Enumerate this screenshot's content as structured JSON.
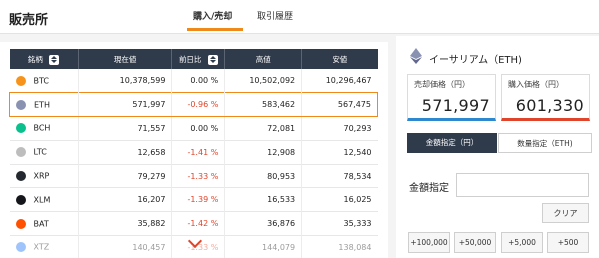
{
  "header": {
    "title": "販売所",
    "tabs": [
      {
        "label": "購入/売却"
      },
      {
        "label": "取引履歴"
      }
    ]
  },
  "table": {
    "columns": [
      "銘柄",
      "現在値",
      "前日比",
      "高値",
      "安値"
    ],
    "rows": [
      {
        "symbol": "BTC",
        "price": "10,378,599",
        "change": "0.00 %",
        "high": "10,502,092",
        "low": "10,296,467",
        "icon_color": "#f7931a"
      },
      {
        "symbol": "ETH",
        "price": "571,997",
        "change": "-0.96 %",
        "high": "583,462",
        "low": "567,475",
        "icon_color": "#8a92b2"
      },
      {
        "symbol": "BCH",
        "price": "71,557",
        "change": "0.00 %",
        "high": "72,081",
        "low": "70,293",
        "icon_color": "#0ac18e"
      },
      {
        "symbol": "LTC",
        "price": "12,658",
        "change": "-1.41 %",
        "high": "12,908",
        "low": "12,540",
        "icon_color": "#bdbdbd"
      },
      {
        "symbol": "XRP",
        "price": "79,279",
        "change": "-1.33 %",
        "high": "80,953",
        "low": "78,534",
        "icon_color": "#23292f"
      },
      {
        "symbol": "XLM",
        "price": "16,207",
        "change": "-1.39 %",
        "high": "16,533",
        "low": "16,025",
        "icon_color": "#14161b"
      },
      {
        "symbol": "BAT",
        "price": "35,882",
        "change": "-1.42 %",
        "high": "36,876",
        "low": "35,333",
        "icon_color": "#ff5000"
      },
      {
        "symbol": "XTZ",
        "price": "140,457",
        "change": "-1.33 %",
        "high": "144,079",
        "low": "138,084",
        "icon_color": "#2c7df7"
      }
    ]
  },
  "trade": {
    "title": "イーサリアム（ETH)",
    "sell_label": "売却価格（円）",
    "sell_price": "571,997",
    "buy_label": "購入価格（円）",
    "buy_price": "601,330",
    "mode_amount": "金額指定（円）",
    "mode_quantity": "数量指定（ETH)",
    "amount_label": "金額指定",
    "amount_value": "",
    "clear_label": "クリア",
    "increments": [
      "+100,000",
      "+50,000",
      "+5,000",
      "+500"
    ]
  },
  "colors": {
    "accent": "#ef8a1a",
    "header_dark": "#2f3a4a",
    "negative": "#e0452b",
    "sell": "#2e88d0",
    "buy": "#e0452b"
  }
}
